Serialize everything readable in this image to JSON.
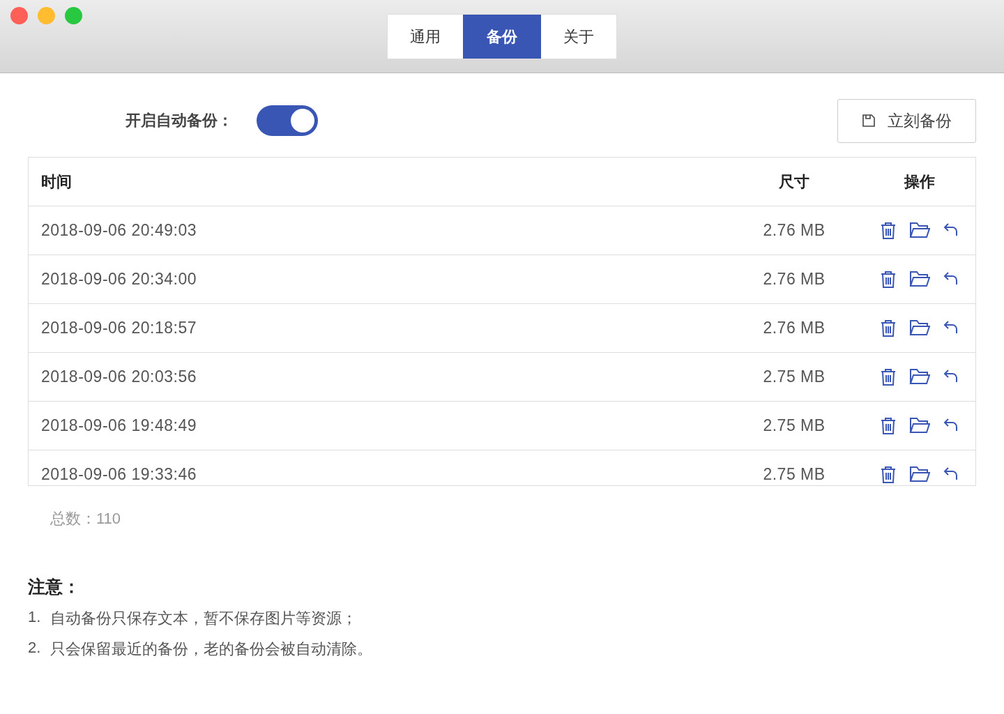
{
  "window": {
    "controls": [
      {
        "kind": "close"
      },
      {
        "kind": "minimize"
      },
      {
        "kind": "zoom"
      }
    ]
  },
  "tabs": [
    {
      "label": "通用",
      "selected": false
    },
    {
      "label": "备份",
      "selected": true
    },
    {
      "label": "关于",
      "selected": false
    }
  ],
  "auto_backup": {
    "label": "开启自动备份：",
    "on": true
  },
  "backup_now_button": "立刻备份",
  "table": {
    "columns": [
      "时间",
      "尺寸",
      "操作"
    ],
    "rows": [
      {
        "time": "2018-09-06 20:49:03",
        "size": "2.76 MB"
      },
      {
        "time": "2018-09-06 20:34:00",
        "size": "2.76 MB"
      },
      {
        "time": "2018-09-06 20:18:57",
        "size": "2.76 MB"
      },
      {
        "time": "2018-09-06 20:03:56",
        "size": "2.75 MB"
      },
      {
        "time": "2018-09-06 19:48:49",
        "size": "2.75 MB"
      },
      {
        "time": "2018-09-06 19:33:46",
        "size": "2.75 MB"
      }
    ]
  },
  "total": "总数：110",
  "notes": {
    "title": "注意：",
    "items": [
      {
        "number": "1.",
        "text": "自动备份只保存文本，暂不保存图片等资源；"
      },
      {
        "number": "2.",
        "text": "只会保留最近的备份，老的备份会被自动清除。"
      }
    ]
  }
}
